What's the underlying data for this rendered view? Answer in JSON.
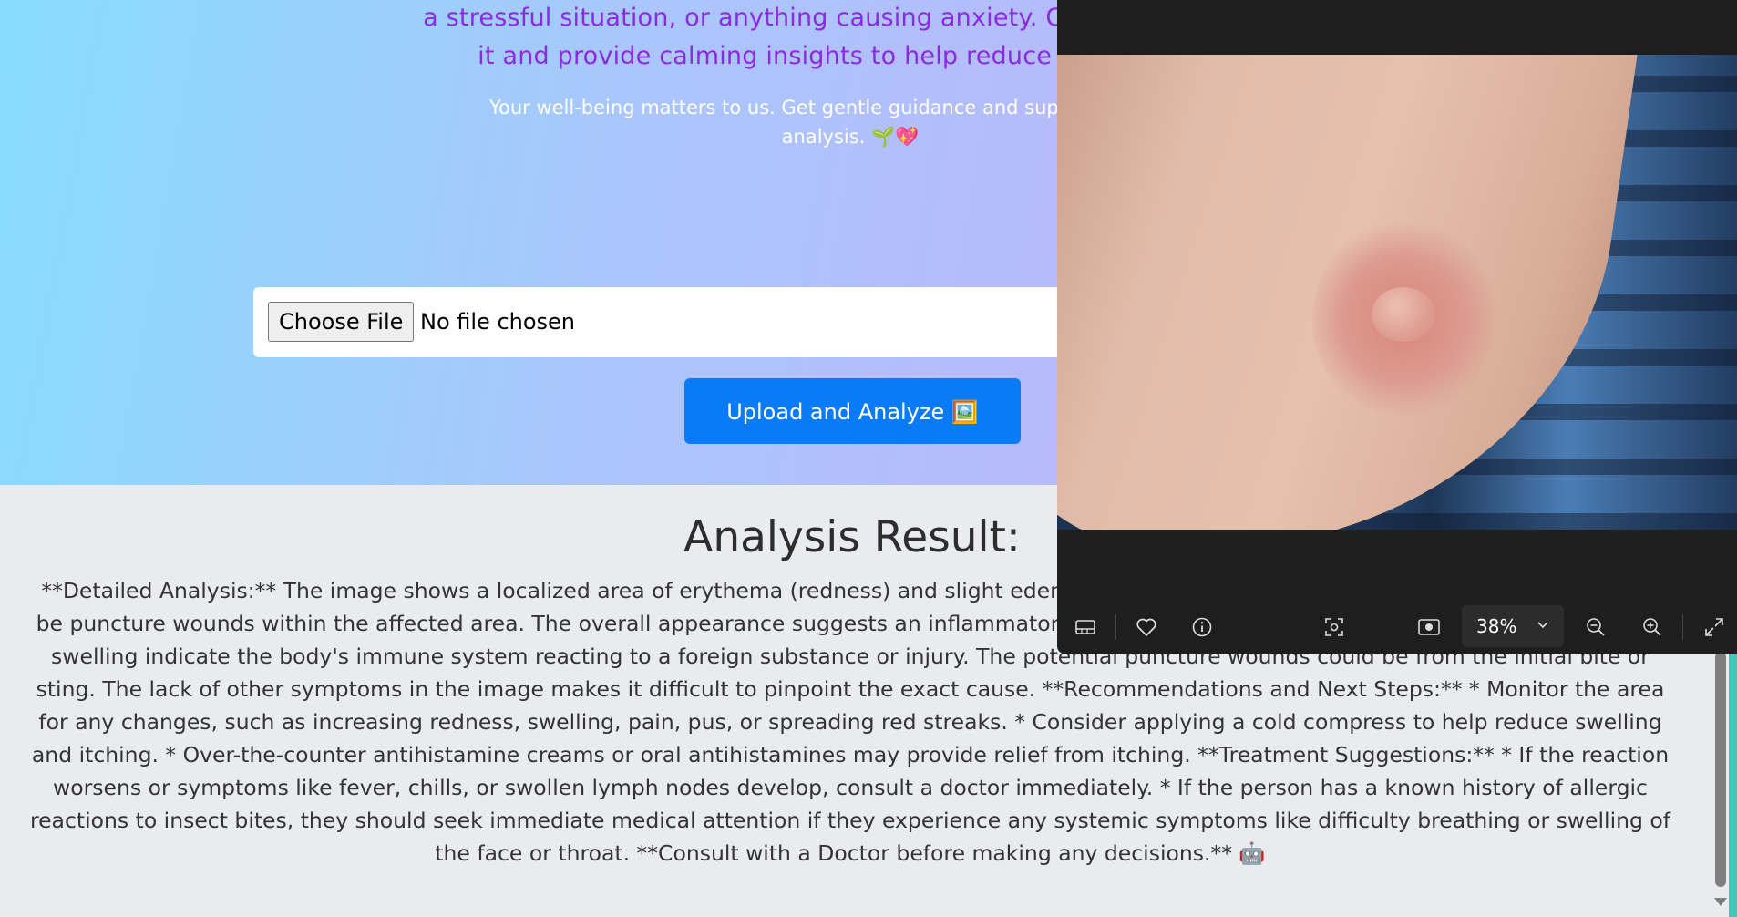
{
  "hero": {
    "intro_line1": "a stressful situation, or anything causing anxiety. Our AI will analyze",
    "intro_line2": "it and provide calming insights to help reduce your worries.",
    "sub_line1": "Your well-being matters to us. Get gentle guidance and support from our AI",
    "sub_line2": "analysis. 🌱💖",
    "choose_file_label": "Choose File",
    "file_status": "No file chosen",
    "upload_button": "Upload and Analyze 🖼️"
  },
  "result": {
    "title": "Analysis Result:",
    "text": "**Detailed Analysis:** The image shows a localized area of erythema (redness) and slight edema (swelling). There are also small red marks that might be puncture wounds within the affected area. The overall appearance suggests an inflammatory reaction. Possible insect bite or sting. The redness and swelling indicate the body's immune system reacting to a foreign substance or injury. The potential puncture wounds could be from the initial bite or sting. The lack of other symptoms in the image makes it difficult to pinpoint the exact cause. **Recommendations and Next Steps:** * Monitor the area for any changes, such as increasing redness, swelling, pain, pus, or spreading red streaks. * Consider applying a cold compress to help reduce swelling and itching. * Over-the-counter antihistamine creams or oral antihistamines may provide relief from itching. **Treatment Suggestions:** * If the reaction worsens or symptoms like fever, chills, or swollen lymph nodes develop, consult a doctor immediately. * If the person has a known history of allergic reactions to insect bites, they should seek immediate medical attention if they experience any systemic symptoms like difficulty breathing or swelling of the face or throat. **Consult with a Doctor before making any decisions.** 🤖"
  },
  "viewer": {
    "zoom_level": "38%",
    "toolbar_icons": [
      "filmstrip-icon",
      "heart-icon",
      "info-icon",
      "visual-search-icon",
      "slideshow-icon",
      "zoom-out-icon",
      "zoom-in-icon",
      "fullscreen-icon"
    ]
  },
  "colors": {
    "intro_text": "#8a2be2",
    "upload_button": "#0a7bf8",
    "viewer_bg": "#1e1e1e"
  }
}
